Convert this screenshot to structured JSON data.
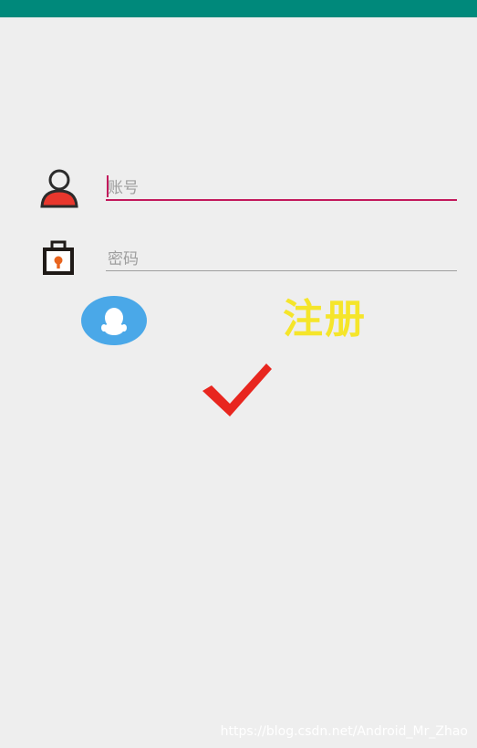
{
  "status_bar": {
    "color": "#00897b"
  },
  "account": {
    "icon": "user-icon",
    "placeholder": "账号",
    "value": "",
    "focused": true,
    "underline_color": "#c2185b"
  },
  "password": {
    "icon": "lock-icon",
    "placeholder": "密码",
    "value": "",
    "underline_color": "#9e9e9e"
  },
  "qq_login": {
    "icon": "qq-icon",
    "color": "#4aa8e8"
  },
  "register": {
    "label": "注册",
    "color": "#f5e52a"
  },
  "confirm": {
    "icon": "checkmark-icon",
    "color": "#e8261f"
  },
  "watermark": {
    "text": "https://blog.csdn.net/Android_Mr_Zhao"
  }
}
